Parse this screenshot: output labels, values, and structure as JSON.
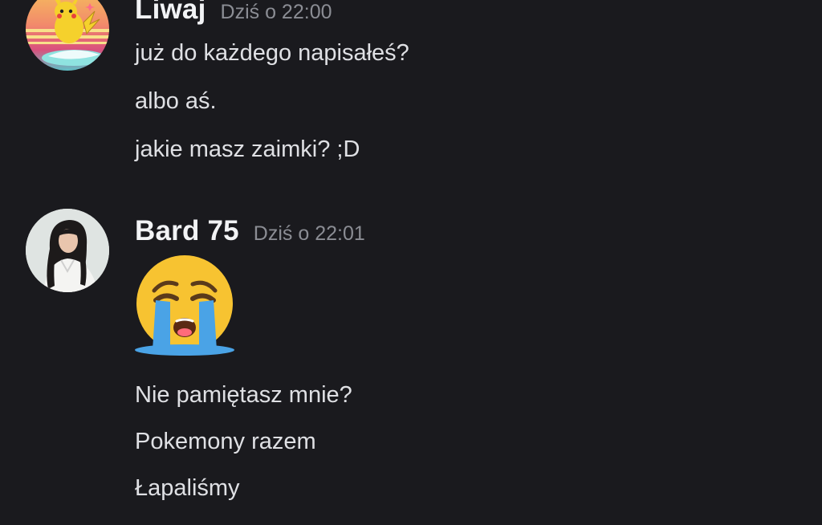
{
  "messages": [
    {
      "author": "Liwaj",
      "timestamp": "Dziś o 22:00",
      "avatar": "pikachu-avatar-icon",
      "lines": [
        "już do każdego napisałeś?",
        "albo aś.",
        "jakie masz zaimki? ;D"
      ]
    },
    {
      "author": "Bard 75",
      "timestamp": "Dziś o 22:01",
      "avatar": "woman-photo-avatar",
      "emoji": "loudly-crying-face-icon",
      "lines": [
        "Nie pamiętasz mnie?",
        "Pokemony razem",
        "Łapaliśmy"
      ]
    }
  ],
  "colors": {
    "background": "#1a1a1e",
    "author": "#f2f3f5",
    "timestamp": "#8b8d94",
    "text": "#dfe0e4",
    "emoji_face": "#f7c331",
    "emoji_tears": "#4aa3e6"
  }
}
